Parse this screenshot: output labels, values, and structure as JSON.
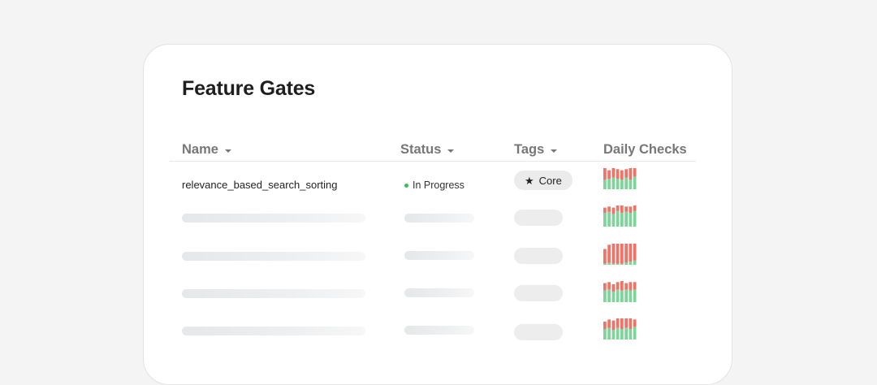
{
  "title": "Feature Gates",
  "columns": {
    "name": "Name",
    "status": "Status",
    "tags": "Tags",
    "daily_checks": "Daily Checks"
  },
  "colors": {
    "pass": "#7fd49a",
    "fail": "#ef7467",
    "status_dot": "#3dbb5b"
  },
  "rows": [
    {
      "name": "relevance_based_search_sorting",
      "status": "In Progress",
      "tag": {
        "icon": "star-icon",
        "label": "Core"
      },
      "checks": [
        {
          "pass": 0.45,
          "fail": 0.55
        },
        {
          "pass": 0.5,
          "fail": 0.4
        },
        {
          "pass": 0.55,
          "fail": 0.45
        },
        {
          "pass": 0.5,
          "fail": 0.45
        },
        {
          "pass": 0.45,
          "fail": 0.45
        },
        {
          "pass": 0.55,
          "fail": 0.4
        },
        {
          "pass": 0.45,
          "fail": 0.55
        },
        {
          "pass": 0.6,
          "fail": 0.4
        }
      ]
    },
    {
      "checks": [
        {
          "pass": 0.65,
          "fail": 0.25
        },
        {
          "pass": 0.7,
          "fail": 0.25
        },
        {
          "pass": 0.6,
          "fail": 0.3
        },
        {
          "pass": 0.75,
          "fail": 0.25
        },
        {
          "pass": 0.65,
          "fail": 0.35
        },
        {
          "pass": 0.7,
          "fail": 0.25
        },
        {
          "pass": 0.65,
          "fail": 0.3
        },
        {
          "pass": 0.75,
          "fail": 0.25
        }
      ]
    },
    {
      "checks": [
        {
          "pass": 0.05,
          "fail": 0.7
        },
        {
          "pass": 0.1,
          "fail": 0.85
        },
        {
          "pass": 0.05,
          "fail": 0.95
        },
        {
          "pass": 0.05,
          "fail": 0.95
        },
        {
          "pass": 0.05,
          "fail": 0.95
        },
        {
          "pass": 0.1,
          "fail": 0.9
        },
        {
          "pass": 0.15,
          "fail": 0.85
        },
        {
          "pass": 0.2,
          "fail": 0.8
        }
      ]
    },
    {
      "checks": [
        {
          "pass": 0.55,
          "fail": 0.35
        },
        {
          "pass": 0.6,
          "fail": 0.35
        },
        {
          "pass": 0.5,
          "fail": 0.35
        },
        {
          "pass": 0.6,
          "fail": 0.35
        },
        {
          "pass": 0.55,
          "fail": 0.45
        },
        {
          "pass": 0.6,
          "fail": 0.3
        },
        {
          "pass": 0.55,
          "fail": 0.4
        },
        {
          "pass": 0.6,
          "fail": 0.35
        }
      ]
    },
    {
      "checks": [
        {
          "pass": 0.5,
          "fail": 0.35
        },
        {
          "pass": 0.55,
          "fail": 0.4
        },
        {
          "pass": 0.45,
          "fail": 0.45
        },
        {
          "pass": 0.55,
          "fail": 0.45
        },
        {
          "pass": 0.5,
          "fail": 0.5
        },
        {
          "pass": 0.55,
          "fail": 0.45
        },
        {
          "pass": 0.5,
          "fail": 0.5
        },
        {
          "pass": 0.6,
          "fail": 0.35
        }
      ]
    }
  ]
}
